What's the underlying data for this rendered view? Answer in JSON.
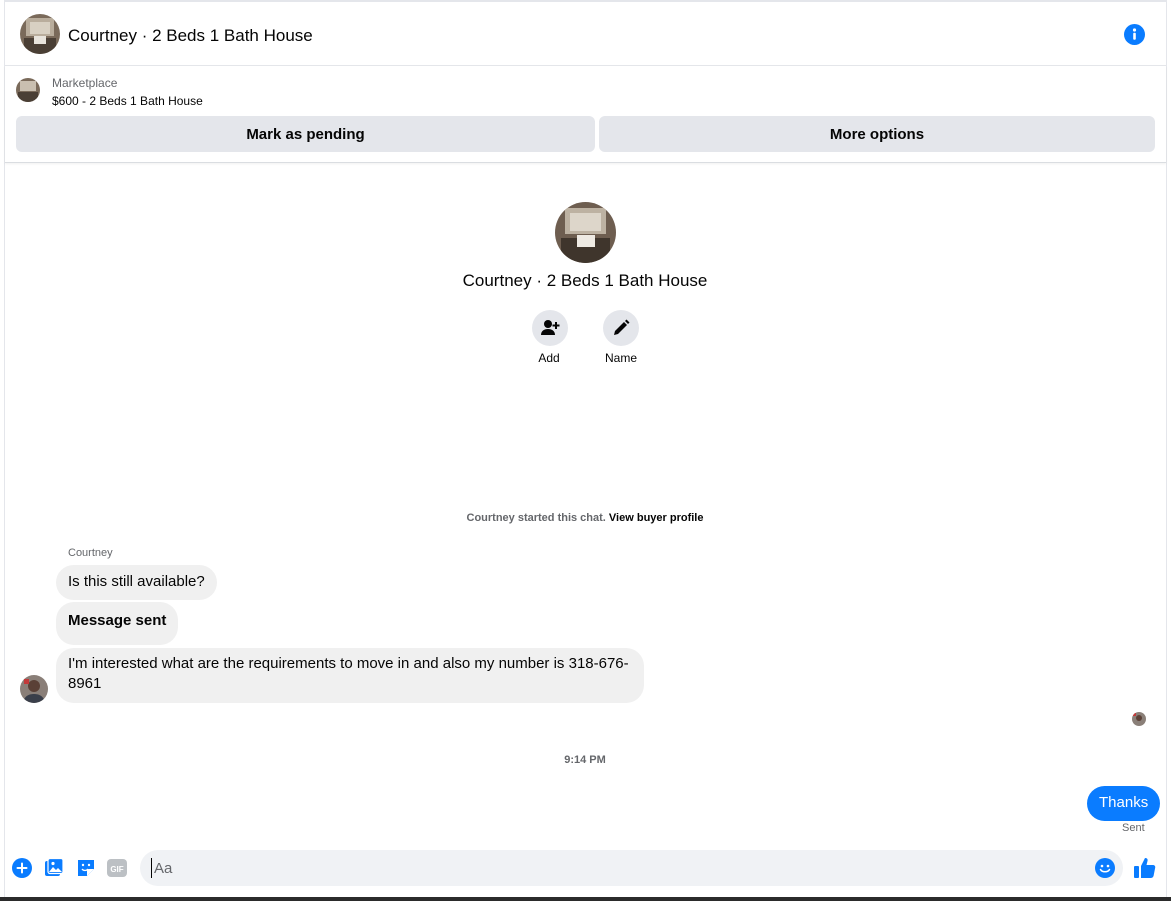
{
  "header": {
    "title": "Courtney · 2 Beds 1 Bath House",
    "info_icon": "info-icon"
  },
  "marketplace": {
    "label": "Marketplace",
    "listing": "$600 - 2 Beds 1 Bath House",
    "mark_pending": "Mark as pending",
    "more_options": "More options"
  },
  "profile": {
    "name": "Courtney · 2 Beds 1 Bath House",
    "add_label": "Add",
    "name_label": "Name"
  },
  "chat": {
    "started_prefix": "Courtney started this chat.",
    "view_profile": "View buyer profile",
    "sender": "Courtney",
    "messages": [
      "Is this still available?",
      "Message sent",
      "I'm interested what are the requirements to move in and also my number is 318-676-8961"
    ],
    "timestamp": "9:14 PM",
    "outgoing": "Thanks",
    "status": "Sent"
  },
  "composer": {
    "placeholder": "Aa",
    "gif_label": "GIF"
  },
  "colors": {
    "accent": "#0a7cff",
    "bubble": "#f0f0f0",
    "button": "#e4e6eb"
  }
}
